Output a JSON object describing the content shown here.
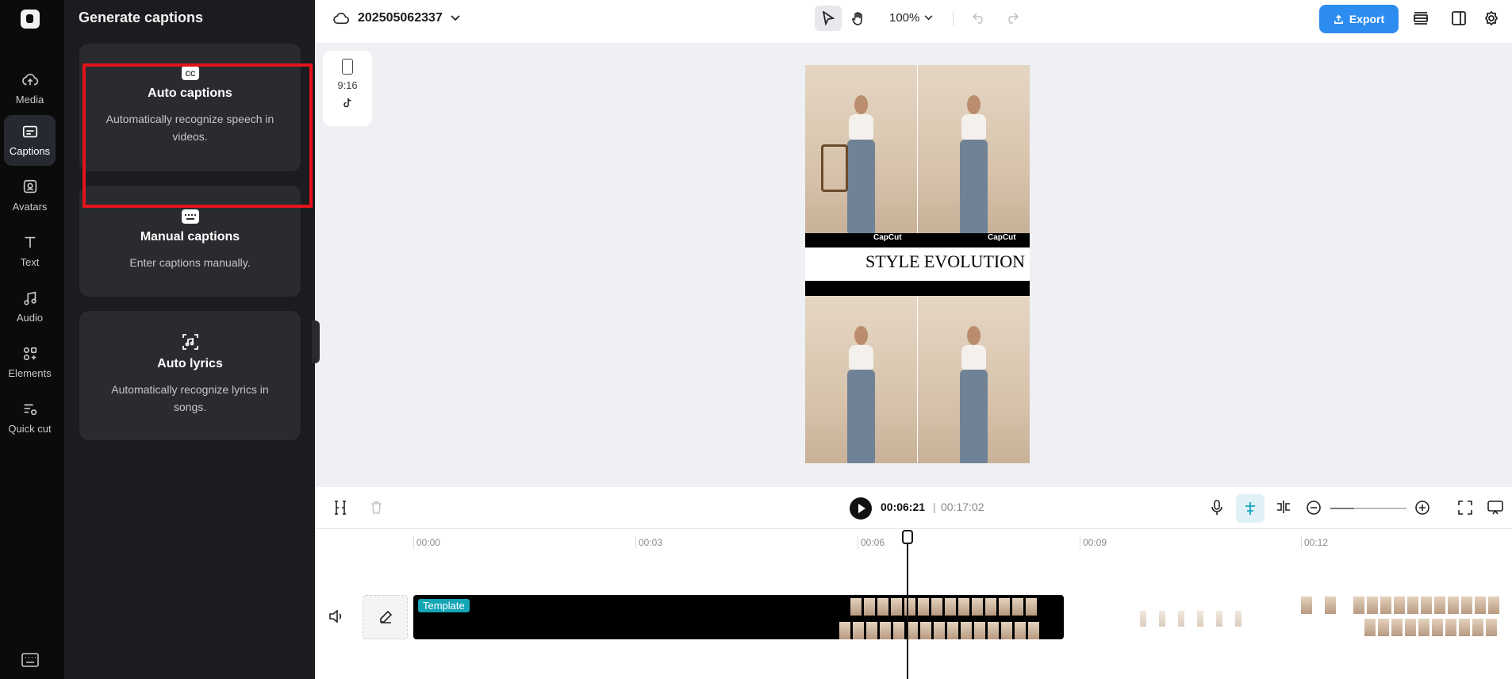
{
  "rail": {
    "items": [
      {
        "label": "Media"
      },
      {
        "label": "Captions"
      },
      {
        "label": "Avatars"
      },
      {
        "label": "Text"
      },
      {
        "label": "Audio"
      },
      {
        "label": "Elements"
      },
      {
        "label": "Quick cut"
      }
    ],
    "active": "Captions"
  },
  "panel": {
    "title": "Generate captions",
    "cards": [
      {
        "title": "Auto captions",
        "desc": "Automatically recognize speech in videos.",
        "icon": "cc-icon"
      },
      {
        "title": "Manual captions",
        "desc": "Enter captions manually.",
        "icon": "keyboard-icon"
      },
      {
        "title": "Auto lyrics",
        "desc": "Automatically recognize lyrics in songs.",
        "icon": "lyrics-icon"
      }
    ]
  },
  "topbar": {
    "project_name": "202505062337",
    "zoom": "100%",
    "export_label": "Export"
  },
  "aspect": {
    "ratio": "9:16"
  },
  "canvas": {
    "brand": "CapCut",
    "headline": "STYLE EVOLUTION"
  },
  "timeline": {
    "current_time": "00:06:21",
    "separator": "|",
    "total_time": "00:17:02",
    "ticks": [
      "00:00",
      "00:03",
      "00:06",
      "00:09",
      "00:12"
    ],
    "clip_badge": "Template"
  },
  "colors": {
    "accent_blue": "#2d8cf0",
    "highlight_red": "#e3141b",
    "badge_teal": "#14a6b6"
  }
}
